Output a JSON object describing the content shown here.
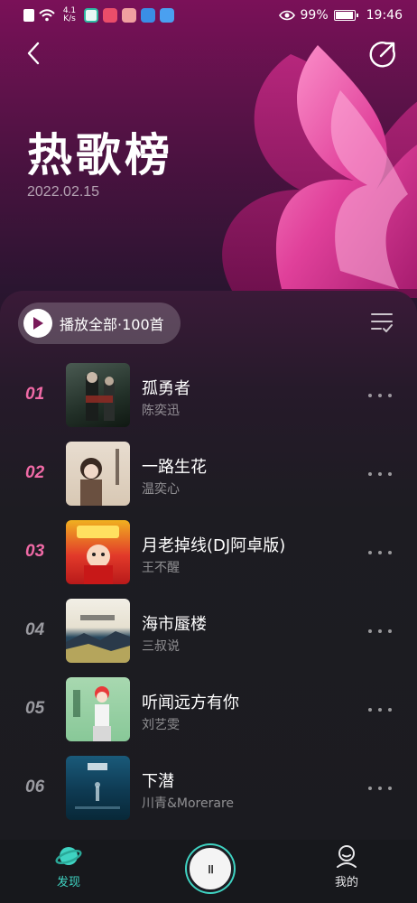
{
  "status_bar": {
    "net_speed_value": "4.1",
    "net_speed_unit": "K/s",
    "battery_percent": "99%",
    "time": "19:46"
  },
  "header": {
    "title": "热歌榜",
    "date": "2022.02.15",
    "back_icon": "chevron-left-icon",
    "share_icon": "share-icon"
  },
  "toolbar": {
    "play_all_label": "播放全部·100首",
    "manage_icon": "list-check-icon"
  },
  "songs": [
    {
      "rank": "01",
      "title": "孤勇者",
      "artist": "陈奕迅",
      "rank_color": "#f06aa6"
    },
    {
      "rank": "02",
      "title": "一路生花",
      "artist": "温奕心",
      "rank_color": "#f06aa6"
    },
    {
      "rank": "03",
      "title": "月老掉线(DJ阿卓版)",
      "artist": "王不醒",
      "rank_color": "#f06aa6"
    },
    {
      "rank": "04",
      "title": "海市蜃楼",
      "artist": "三叔说",
      "rank_color": "#9a9aa0"
    },
    {
      "rank": "05",
      "title": "听闻远方有你",
      "artist": "刘艺雯",
      "rank_color": "#9a9aa0"
    },
    {
      "rank": "06",
      "title": "下潜",
      "artist": "川青&Morerare",
      "rank_color": "#9a9aa0"
    }
  ],
  "bottom_nav": {
    "discover_label": "发现",
    "mine_label": "我的",
    "player_glyph": "॥",
    "active_color": "#3fd3c2"
  }
}
